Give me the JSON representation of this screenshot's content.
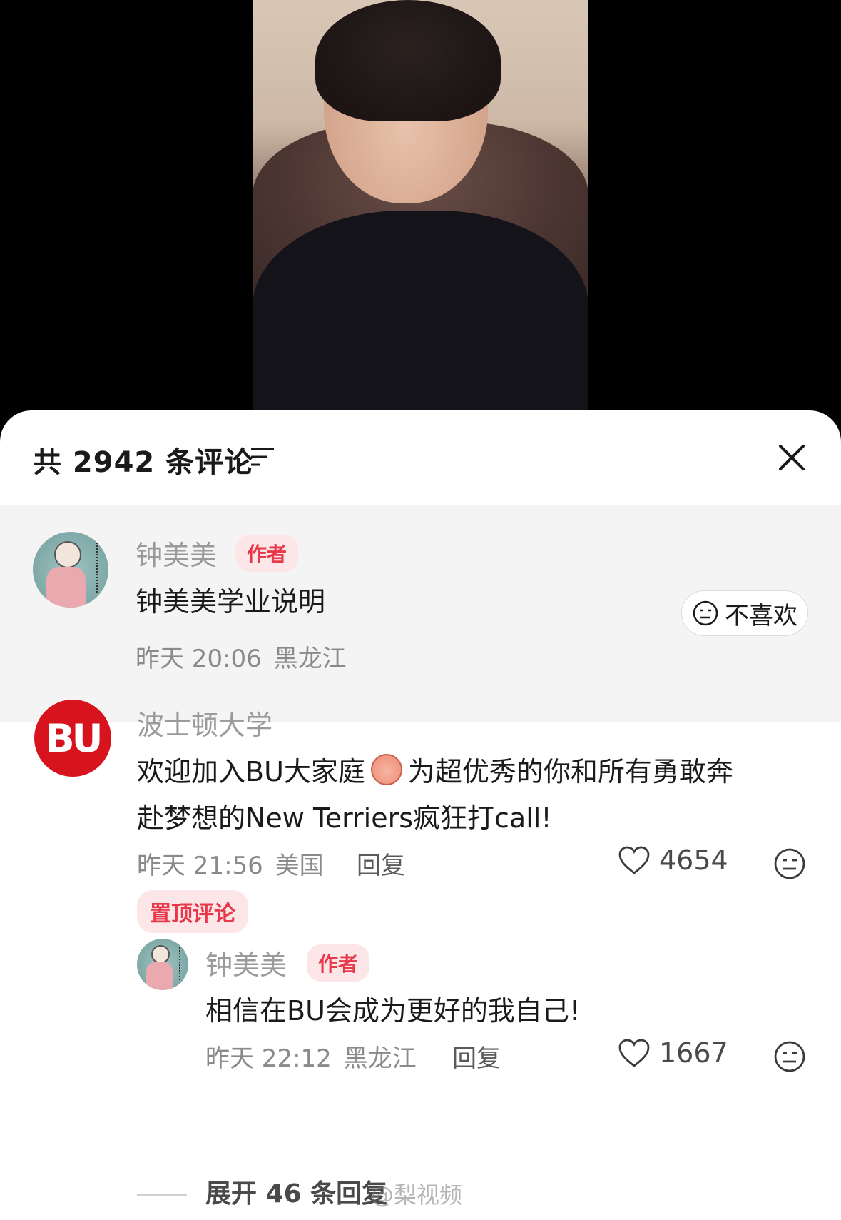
{
  "header": {
    "comment_count_title": "共 2942 条评论"
  },
  "author_post": {
    "name": "钟美美",
    "badge": "作者",
    "text": "钟美美学业说明",
    "time": "昨天 20:06",
    "location": "黑龙江",
    "dislike_label": "不喜欢"
  },
  "comments": [
    {
      "name": "波士顿大学",
      "avatar_text": "BU",
      "text_line1_a": "欢迎加入BU大家庭",
      "text_line1_b": "为超优秀的你和所有勇敢奔",
      "text_line2": "赴梦想的New Terriers疯狂打call!",
      "time": "昨天 21:56",
      "location": "美国",
      "reply_label": "回复",
      "likes": "4654",
      "pinned_label": "置顶评论",
      "replies": [
        {
          "name": "钟美美",
          "badge": "作者",
          "text": "相信在BU会成为更好的我自己!",
          "time": "昨天 22:12",
          "location": "黑龙江",
          "reply_label": "回复",
          "likes": "1667"
        }
      ],
      "expand_label": "展开 46 条回复"
    }
  ],
  "watermark": "@梨视频",
  "colors": {
    "accent_red": "#e8394a",
    "badge_bg": "#fde6e8",
    "bu_red": "#d7141d"
  },
  "icons": {
    "filter": "filter-icon",
    "close": "close-icon",
    "like": "heart-icon",
    "dislike": "neutral-face-icon"
  }
}
